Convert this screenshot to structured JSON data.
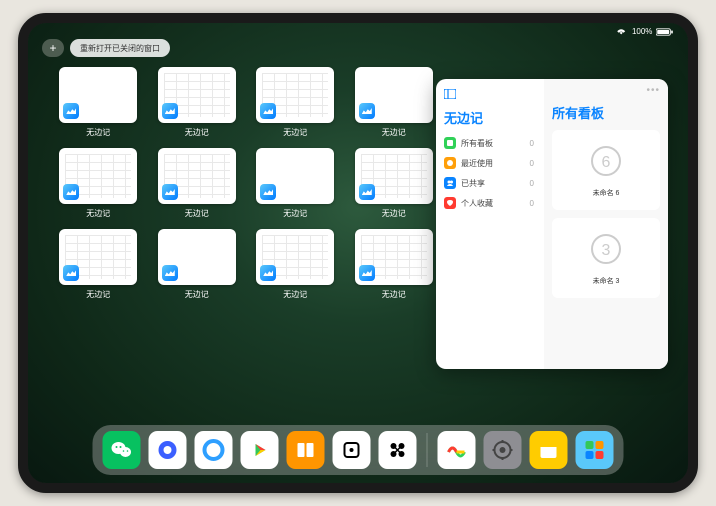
{
  "status": {
    "battery": "100%"
  },
  "controls": {
    "plus": "+",
    "reopen_label": "重新打开已关闭的窗口"
  },
  "app_name": "无边记",
  "thumbnails": [
    {
      "label": "无边记",
      "variant": "blank"
    },
    {
      "label": "无边记",
      "variant": "calendar"
    },
    {
      "label": "无边记",
      "variant": "calendar"
    },
    {
      "label": "无边记",
      "variant": "blank"
    },
    {
      "label": "无边记",
      "variant": "calendar"
    },
    {
      "label": "无边记",
      "variant": "calendar"
    },
    {
      "label": "无边记",
      "variant": "blank"
    },
    {
      "label": "无边记",
      "variant": "calendar"
    },
    {
      "label": "无边记",
      "variant": "calendar"
    },
    {
      "label": "无边记",
      "variant": "blank"
    },
    {
      "label": "无边记",
      "variant": "calendar"
    },
    {
      "label": "无边记",
      "variant": "calendar"
    }
  ],
  "panel": {
    "left_title": "无边记",
    "items": [
      {
        "label": "所有看板",
        "count": "0",
        "color": "#30d158"
      },
      {
        "label": "最近使用",
        "count": "0",
        "color": "#ff9f0a"
      },
      {
        "label": "已共享",
        "count": "0",
        "color": "#0a84ff"
      },
      {
        "label": "个人收藏",
        "count": "0",
        "color": "#ff3b30"
      }
    ],
    "right_title": "所有看板",
    "boards": [
      {
        "name": "未命名 6",
        "digit": "6"
      },
      {
        "name": "未命名 3",
        "digit": "3"
      }
    ]
  },
  "dock": [
    {
      "name": "wechat",
      "bg": "#07c160"
    },
    {
      "name": "browser-1",
      "bg": "#ffffff"
    },
    {
      "name": "browser-2",
      "bg": "#ffffff"
    },
    {
      "name": "media",
      "bg": "#ffffff"
    },
    {
      "name": "books",
      "bg": "#ff9500"
    },
    {
      "name": "dice",
      "bg": "#ffffff"
    },
    {
      "name": "connect",
      "bg": "#ffffff"
    },
    {
      "name": "freeform",
      "bg": "#ffffff"
    },
    {
      "name": "settings",
      "bg": "#8e8e93"
    },
    {
      "name": "notes",
      "bg": "#ffcc00"
    },
    {
      "name": "app-library",
      "bg": "#5ac8fa"
    }
  ]
}
